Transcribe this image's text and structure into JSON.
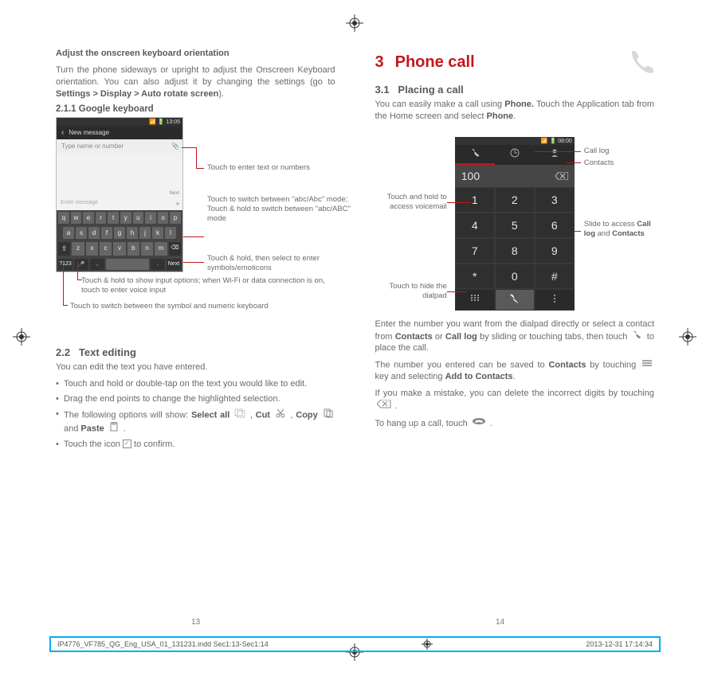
{
  "left": {
    "adjust_heading": "Adjust the onscreen keyboard orientation",
    "adjust_para": "Turn the phone sideways or upright to adjust the Onscreen Keyboard orientation. You can also adjust it by changing the settings (go to ",
    "adjust_bold": "Settings > Display > Auto rotate screen",
    "adjust_close": ").",
    "sec_211": "2.1.1   Google keyboard",
    "kb": {
      "time": "13:05",
      "title": "New message",
      "placeholder": "Type name or number",
      "next_small": "Next",
      "enter_msg": "Enter message",
      "row1": [
        "q",
        "w",
        "e",
        "r",
        "t",
        "y",
        "u",
        "i",
        "o",
        "p"
      ],
      "row2": [
        "a",
        "s",
        "d",
        "f",
        "g",
        "h",
        "j",
        "k",
        "l"
      ],
      "row3_shift": "⇧",
      "row3": [
        "z",
        "x",
        "c",
        "v",
        "b",
        "n",
        "m"
      ],
      "row3_del": "⌫",
      "row4_sym": "?123",
      "row4_mic": "🎤",
      "row4_comma": ",",
      "row4_dot": ".",
      "row4_next": "Next"
    },
    "kb_captions": {
      "c1": "Touch to enter text or numbers",
      "c2": "Touch to switch  between \"abc/Abc\" mode; Touch & hold to switch between \"abc/ABC\" mode",
      "c3": "Touch & hold, then select to enter symbols/emoticons",
      "c4": "Touch & hold to show input options; when Wi-Fi or data connection is on, touch to enter voice input",
      "c5": "Touch to switch between the symbol and numeric keyboard"
    },
    "sec_22_num": "2.2",
    "sec_22_title": "Text editing",
    "edit_intro": "You can edit the text you have entered.",
    "b1": "Touch and hold or double-tap on the text you would like to edit.",
    "b2": "Drag the end points to change the highlighted selection.",
    "b3_a": "The following options will show: ",
    "b3_selectall": "Select all",
    "b3_cut": "Cut",
    "b3_copy": "Copy",
    "b3_and": " and ",
    "b3_paste": "Paste",
    "b4": "Touch the icon ",
    "b4_end": " to confirm."
  },
  "right": {
    "ch_num": "3",
    "ch_title": "Phone call",
    "sec_31_num": "3.1",
    "sec_31_title": "Placing a call",
    "p1_a": "You can easily make a call using ",
    "p1_phone": "Phone.",
    "p1_b": " Touch the Application tab from the Home screen and select ",
    "p1_phone2": "Phone",
    "p1_c": ".",
    "ph": {
      "time": "08:00",
      "display": "100",
      "keys": [
        [
          "1",
          "2",
          "3"
        ],
        [
          "4",
          "5",
          "6"
        ],
        [
          "7",
          "8",
          "9"
        ],
        [
          "*",
          "0",
          "#"
        ]
      ]
    },
    "captions": {
      "call_log": "Call log",
      "contacts": "Contacts",
      "voicemail": "Touch and hold to access voicemail",
      "hide": "Touch to hide the dialpad",
      "slide_a": "Slide to access ",
      "slide_b": "Call log",
      "slide_c": " and ",
      "slide_d": "Contacts"
    },
    "p2_a": "Enter the number you want from the dialpad directly or select a contact from ",
    "p2_contacts": "Contacts",
    "p2_or": " or ",
    "p2_calllog": "Call log",
    "p2_b": " by sliding or touching tabs, then touch ",
    "p2_c": " to place the call.",
    "p3_a": "The number you entered can be saved to ",
    "p3_contacts": "Contacts",
    "p3_b": " by touching ",
    "p3_c": " key and selecting ",
    "p3_add": "Add to Contacts",
    "p3_d": ".",
    "p4_a": "If you make a mistake, you can delete the incorrect digits by touching ",
    "p4_b": " .",
    "p5_a": "To hang up a call, touch ",
    "p5_b": " ."
  },
  "page_left": "13",
  "page_right": "14",
  "footer": {
    "file": "IP4776_VF785_QG_Eng_USA_01_131231.indd   Sec1:13-Sec1:14",
    "date": "2013-12-31   17:14:34"
  }
}
